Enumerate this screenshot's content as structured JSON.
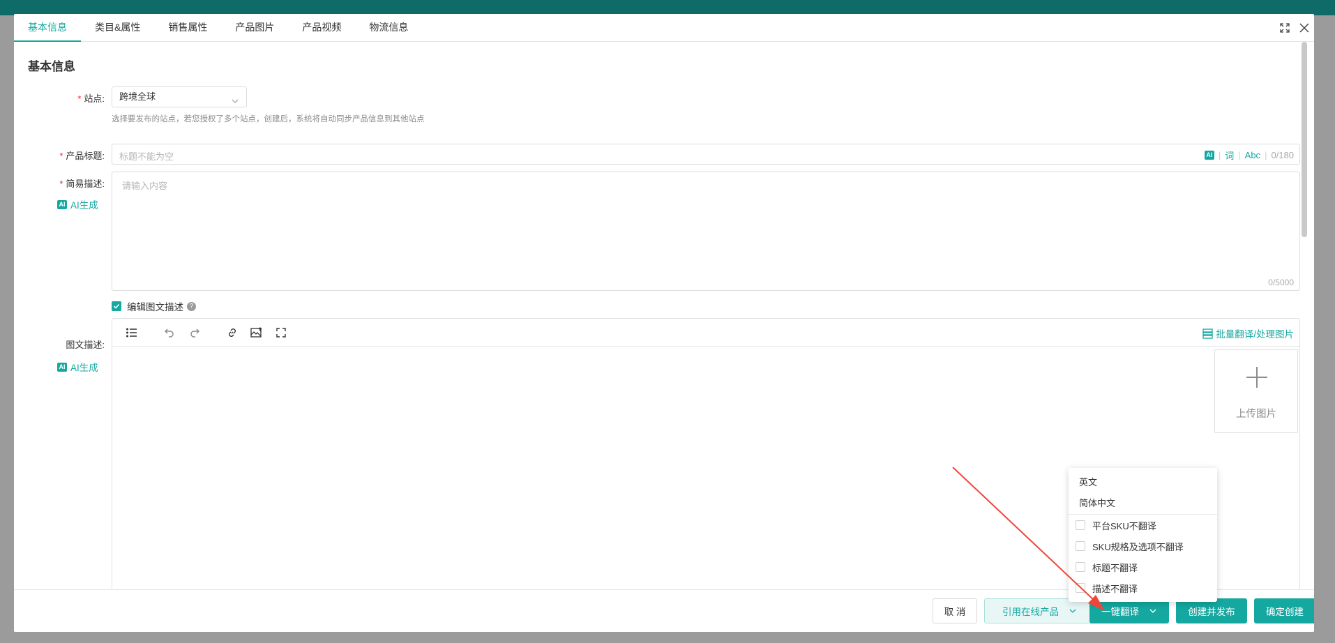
{
  "tabs": [
    "基本信息",
    "类目&属性",
    "销售属性",
    "产品图片",
    "产品视频",
    "物流信息"
  ],
  "section_title": "基本信息",
  "site": {
    "label": "站点:",
    "value": "跨境全球",
    "hint": "选择要发布的站点，若您授权了多个站点，创建后，系统将自动同步产品信息到其他站点"
  },
  "product_title": {
    "label": "产品标题:",
    "placeholder": "标题不能为空",
    "ai": "AI",
    "word": "词",
    "abc": "Abc",
    "count": "0/180"
  },
  "short_desc": {
    "label": "简易描述:",
    "ai_gen": "AI生成",
    "placeholder": "请输入内容",
    "count": "0/5000"
  },
  "edit_rich_desc": {
    "label": "编辑图文描述",
    "checked": true
  },
  "rich_desc": {
    "label": "图文描述:",
    "ai_gen": "AI生成",
    "batch_translate": "批量翻译/处理图片",
    "upload_label": "上传图片"
  },
  "dropdown": {
    "languages": [
      "英文",
      "简体中文"
    ],
    "options": [
      "平台SKU不翻译",
      "SKU规格及选项不翻译",
      "标题不翻译",
      "描述不翻译"
    ]
  },
  "footer": {
    "cancel": "取 消",
    "reference_online": "引用在线产品",
    "one_click_translate": "一键翻译",
    "create_publish": "创建并发布",
    "confirm_create": "确定创建"
  },
  "colors": {
    "accent": "#14a8a0",
    "required": "#f5222d",
    "arrow": "#f0453a"
  }
}
